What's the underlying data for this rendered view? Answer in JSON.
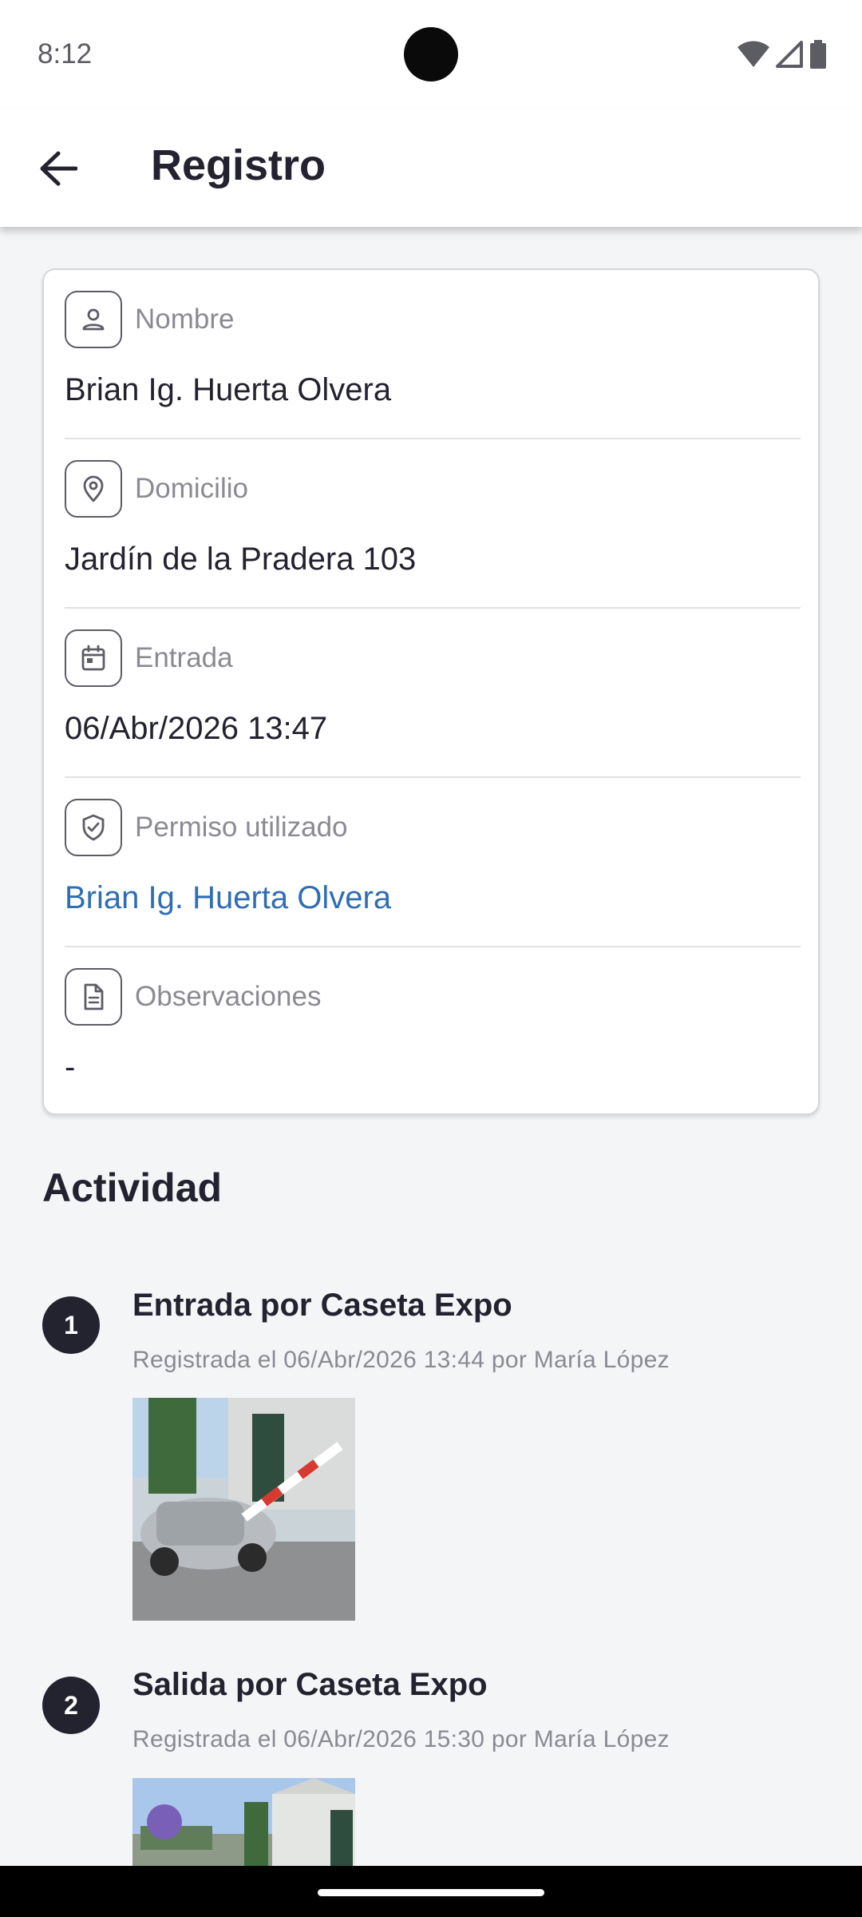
{
  "status_bar": {
    "time": "8:12"
  },
  "app_bar": {
    "title": "Registro",
    "back_icon": "arrow-left-icon"
  },
  "record": {
    "fields": [
      {
        "label": "Nombre",
        "value": "Brian Ig. Huerta Olvera",
        "icon": "person-icon"
      },
      {
        "label": "Domicilio",
        "value": "Jardín de la Pradera 103",
        "icon": "location-pin-icon"
      },
      {
        "label": "Entrada",
        "value": "06/Abr/2026 13:47",
        "icon": "calendar-icon"
      },
      {
        "label": "Permiso utilizado",
        "value": "Brian Ig. Huerta Olvera",
        "icon": "shield-check-icon",
        "link": true
      },
      {
        "label": "Observaciones",
        "value": "-",
        "icon": "document-icon"
      }
    ]
  },
  "activity": {
    "title": "Actividad",
    "items": [
      {
        "step": "1",
        "title": "Entrada por Caseta Expo",
        "subtitle": "Registrada el 06/Abr/2026 13:44 por María López"
      },
      {
        "step": "2",
        "title": "Salida por Caseta Expo",
        "subtitle": "Registrada el 06/Abr/2026 15:30 por María López"
      }
    ]
  },
  "colors": {
    "accent_link": "#2f6db5",
    "text_primary": "#23222f",
    "text_secondary": "#8a8a93",
    "background": "#f4f5f7"
  }
}
